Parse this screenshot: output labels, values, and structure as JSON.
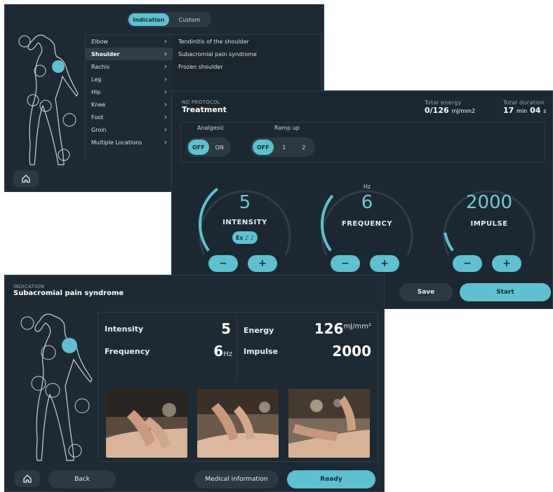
{
  "colors": {
    "accent": "#5ec0d0",
    "panel": "#1e2a33",
    "panel_alt": "#2b3943"
  },
  "screen1": {
    "tabs": [
      "Indication",
      "Custom"
    ],
    "active_tab": "Indication",
    "locations": [
      "Elbow",
      "Shoulder",
      "Rachis",
      "Leg",
      "Hip",
      "Knee",
      "Foot",
      "Groin",
      "Multiple Locations"
    ],
    "selected_location": "Shoulder",
    "indications": [
      "Tendinitis of the shoulder",
      "Subacromial pain syndrome",
      "Frozen shoulder"
    ],
    "home_icon": "home-icon"
  },
  "screen2": {
    "protocol_label": "NO PROTOCOL",
    "title": "Treatment",
    "total_energy_label": "Total energy",
    "total_energy_value": "0/126",
    "total_energy_unit": "mJ/mm2",
    "total_duration_label": "Total duration",
    "duration_min": "17",
    "duration_min_unit": "min",
    "duration_sec": "04",
    "duration_sec_unit": "s",
    "analgesic_label": "Analgesic",
    "analgesic_options": [
      "OFF",
      "ON"
    ],
    "analgesic_selected": "OFF",
    "rampup_label": "Ramp up",
    "rampup_options": [
      "OFF",
      "1",
      "2"
    ],
    "rampup_selected": "OFF",
    "dials": [
      {
        "label": "INTENSITY",
        "value": "5",
        "unit": "",
        "badge": "Es ♪ ♪",
        "level": 0.35
      },
      {
        "label": "FREQUENCY",
        "value": "6",
        "unit": "Hz",
        "badge": "",
        "level": 0.3
      },
      {
        "label": "IMPULSE",
        "value": "2000",
        "unit": "",
        "badge": "",
        "level": 0.1
      }
    ],
    "minus": "−",
    "plus": "+",
    "save_label": "Save",
    "start_label": "Start"
  },
  "screen3": {
    "indication_label": "INDICATION",
    "title": "Subacromial pain syndrome",
    "intensity_label": "Intensity",
    "intensity_value": "5",
    "frequency_label": "Frequency",
    "frequency_value": "6",
    "frequency_unit": "Hz",
    "energy_label": "Energy",
    "energy_value": "126",
    "energy_unit": "mJ/mm²",
    "impulse_label": "Impulse",
    "impulse_value": "2000",
    "back_label": "Back",
    "medical_label": "Medical information",
    "ready_label": "Ready",
    "home_icon": "home-icon"
  }
}
